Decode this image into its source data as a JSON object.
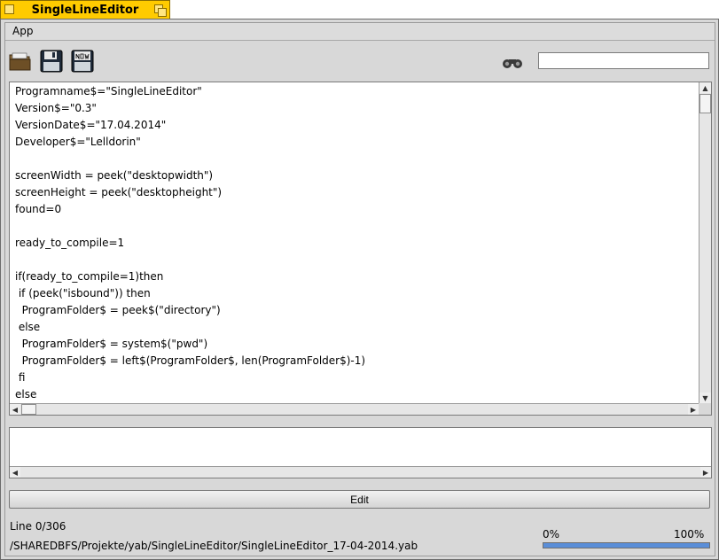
{
  "window": {
    "title": "SingleLineEditor"
  },
  "menubar": {
    "app_label": "App"
  },
  "toolbar": {
    "icons": [
      "open-folder-icon",
      "save-icon",
      "save-new-icon",
      "binoculars-icon"
    ],
    "search_value": ""
  },
  "editor": {
    "lines": [
      "Programname$=\"SingleLineEditor\"",
      "Version$=\"0.3\"",
      "VersionDate$=\"17.04.2014\"",
      "Developer$=\"Lelldorin\"",
      "",
      "screenWidth = peek(\"desktopwidth\")",
      "screenHeight = peek(\"desktopheight\")",
      "found=0",
      "",
      "ready_to_compile=1",
      "",
      "if(ready_to_compile=1)then",
      " if (peek(\"isbound\")) then",
      "  ProgramFolder$ = peek$(\"directory\")",
      " else",
      "  ProgramFolder$ = system$(\"pwd\")",
      "  ProgramFolder$ = left$(ProgramFolder$, len(ProgramFolder$)-1)",
      " fi",
      "else"
    ]
  },
  "output": {
    "text": ""
  },
  "edit_button": {
    "label": "Edit"
  },
  "status": {
    "line_info": "Line 0/306",
    "file_path": "/SHAREDBFS/Projekte/yab/SingleLineEditor/SingleLineEditor_17-04-2014.yab"
  },
  "progress": {
    "min_label": "0%",
    "max_label": "100%",
    "value_percent": 100,
    "fill_color": "#5a8ed8"
  },
  "colors": {
    "tab_yellow": "#ffcb00",
    "panel_gray": "#d8d8d8"
  }
}
